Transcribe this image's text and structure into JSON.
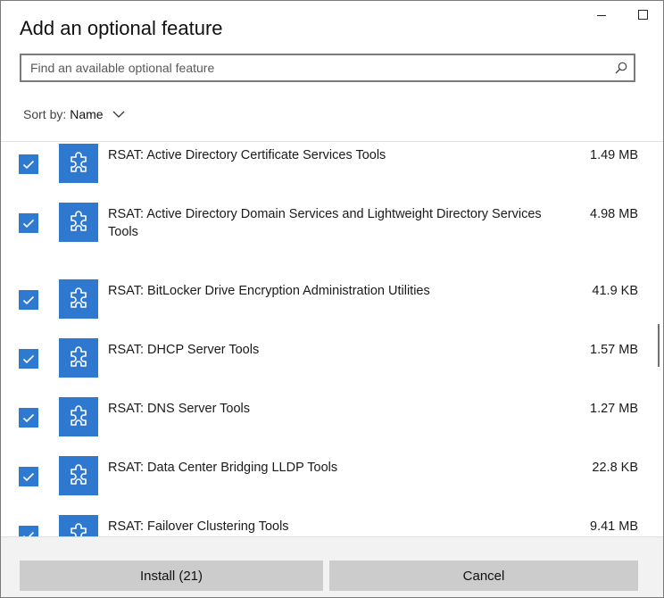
{
  "window": {
    "title": "Add an optional feature",
    "controls": [
      "minimize-icon",
      "maximize-icon"
    ]
  },
  "search": {
    "placeholder": "Find an available optional feature",
    "value": "",
    "icon": "search-icon"
  },
  "sort": {
    "label": "Sort by:",
    "value": "Name",
    "icon": "chevron-down-icon"
  },
  "features": [
    {
      "name": "RSAT: Active Directory Certificate Services Tools",
      "size": "1.49 MB",
      "checked": true
    },
    {
      "name": "RSAT: Active Directory Domain Services and Lightweight Directory Services Tools",
      "size": "4.98 MB",
      "checked": true
    },
    {
      "name": "RSAT: BitLocker Drive Encryption Administration Utilities",
      "size": "41.9 KB",
      "checked": true
    },
    {
      "name": "RSAT: DHCP Server Tools",
      "size": "1.57 MB",
      "checked": true
    },
    {
      "name": "RSAT: DNS Server Tools",
      "size": "1.27 MB",
      "checked": true
    },
    {
      "name": "RSAT: Data Center Bridging LLDP Tools",
      "size": "22.8 KB",
      "checked": true
    },
    {
      "name": "RSAT: Failover Clustering Tools",
      "size": "9.41 MB",
      "checked": true
    }
  ],
  "feature_icon": "puzzle-piece-icon",
  "colors": {
    "accent": "#2f7ad1",
    "button_bg": "#cccccc",
    "footer_bg": "#f2f2f2"
  },
  "footer": {
    "install_label": "Install (21)",
    "cancel_label": "Cancel"
  }
}
